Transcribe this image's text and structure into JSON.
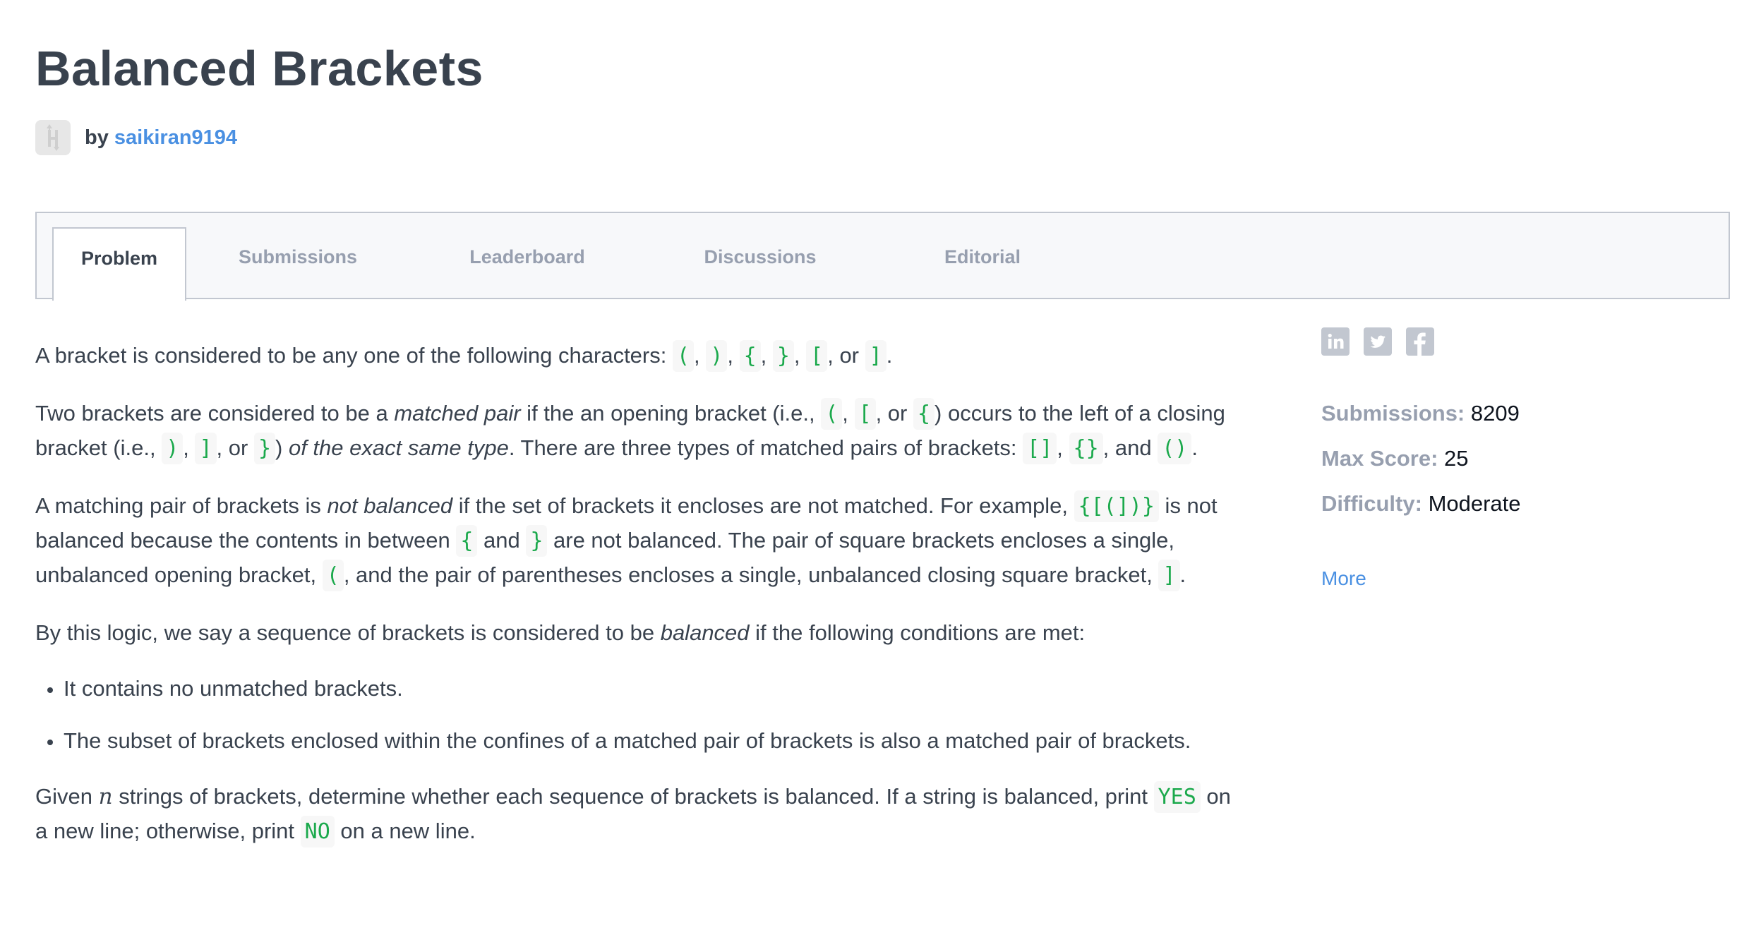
{
  "header": {
    "title": "Balanced Brackets",
    "by_label": "by",
    "author": "saikiran9194",
    "avatar_icon": "hackerrank-logo-icon"
  },
  "tabs": [
    {
      "label": "Problem",
      "active": true
    },
    {
      "label": "Submissions",
      "active": false
    },
    {
      "label": "Leaderboard",
      "active": false
    },
    {
      "label": "Discussions",
      "active": false
    },
    {
      "label": "Editorial",
      "active": false
    }
  ],
  "problem": {
    "p1": {
      "t0": "A bracket is considered to be any one of the following characters: ",
      "c0": "(",
      "t1": ", ",
      "c1": ")",
      "t2": ", ",
      "c2": "{",
      "t3": ", ",
      "c3": "}",
      "t4": ", ",
      "c4": "[",
      "t5": ", or ",
      "c5": "]",
      "t6": "."
    },
    "p2": {
      "t0": "Two brackets are considered to be a ",
      "em0": "matched pair",
      "t1": " if the an opening bracket (i.e., ",
      "c0": "(",
      "t2": ", ",
      "c1": "[",
      "t3": ", or ",
      "c2": "{",
      "t4": ") occurs to the left of a closing bracket (i.e., ",
      "c3": ")",
      "t5": ", ",
      "c4": "]",
      "t6": ", or ",
      "c5": "}",
      "t7": ") ",
      "em1": "of the exact same type",
      "t8": ". There are three types of matched pairs of brackets: ",
      "c6": "[]",
      "t9": ", ",
      "c7": "{}",
      "t10": ", and ",
      "c8": "()",
      "t11": "."
    },
    "p3": {
      "t0": "A matching pair of brackets is ",
      "em0": "not balanced",
      "t1": " if the set of brackets it encloses are not matched. For example, ",
      "c0": "{[(])}",
      "t2": " is not balanced because the contents in between ",
      "c1": "{",
      "t3": " and ",
      "c2": "}",
      "t4": " are not balanced. The pair of square brackets encloses a single, unbalanced opening bracket, ",
      "c3": "(",
      "t5": ", and the pair of parentheses encloses a single, unbalanced closing square bracket, ",
      "c4": "]",
      "t6": "."
    },
    "p4": {
      "t0": "By this logic, we say a sequence of brackets is considered to be ",
      "em0": "balanced",
      "t1": " if the following conditions are met:"
    },
    "conditions": [
      "It contains no unmatched brackets.",
      "The subset of brackets enclosed within the confines of a matched pair of brackets is also a matched pair of brackets."
    ],
    "p5": {
      "t0": "Given ",
      "math0": "n",
      "t1": " strings of brackets, determine whether each sequence of brackets is balanced. If a string is balanced, print ",
      "c0": "YES",
      "t2": " on a new line; otherwise, print ",
      "c1": "NO",
      "t3": " on a new line."
    }
  },
  "sidebar": {
    "social": [
      {
        "icon": "linkedin-icon",
        "glyph": "in"
      },
      {
        "icon": "twitter-icon"
      },
      {
        "icon": "facebook-icon",
        "glyph": "f"
      }
    ],
    "stats": [
      {
        "label": "Submissions:",
        "value": "8209"
      },
      {
        "label": "Max Score:",
        "value": "25"
      },
      {
        "label": "Difficulty:",
        "value": "Moderate"
      }
    ],
    "more_label": "More"
  },
  "colors": {
    "text": "#39424e",
    "muted": "#979faf",
    "link": "#4a90e2",
    "code_text": "#1ba94c",
    "code_bg": "#f7f7f7",
    "tab_bg": "#f7f8fa",
    "border": "#c2c7d0"
  }
}
